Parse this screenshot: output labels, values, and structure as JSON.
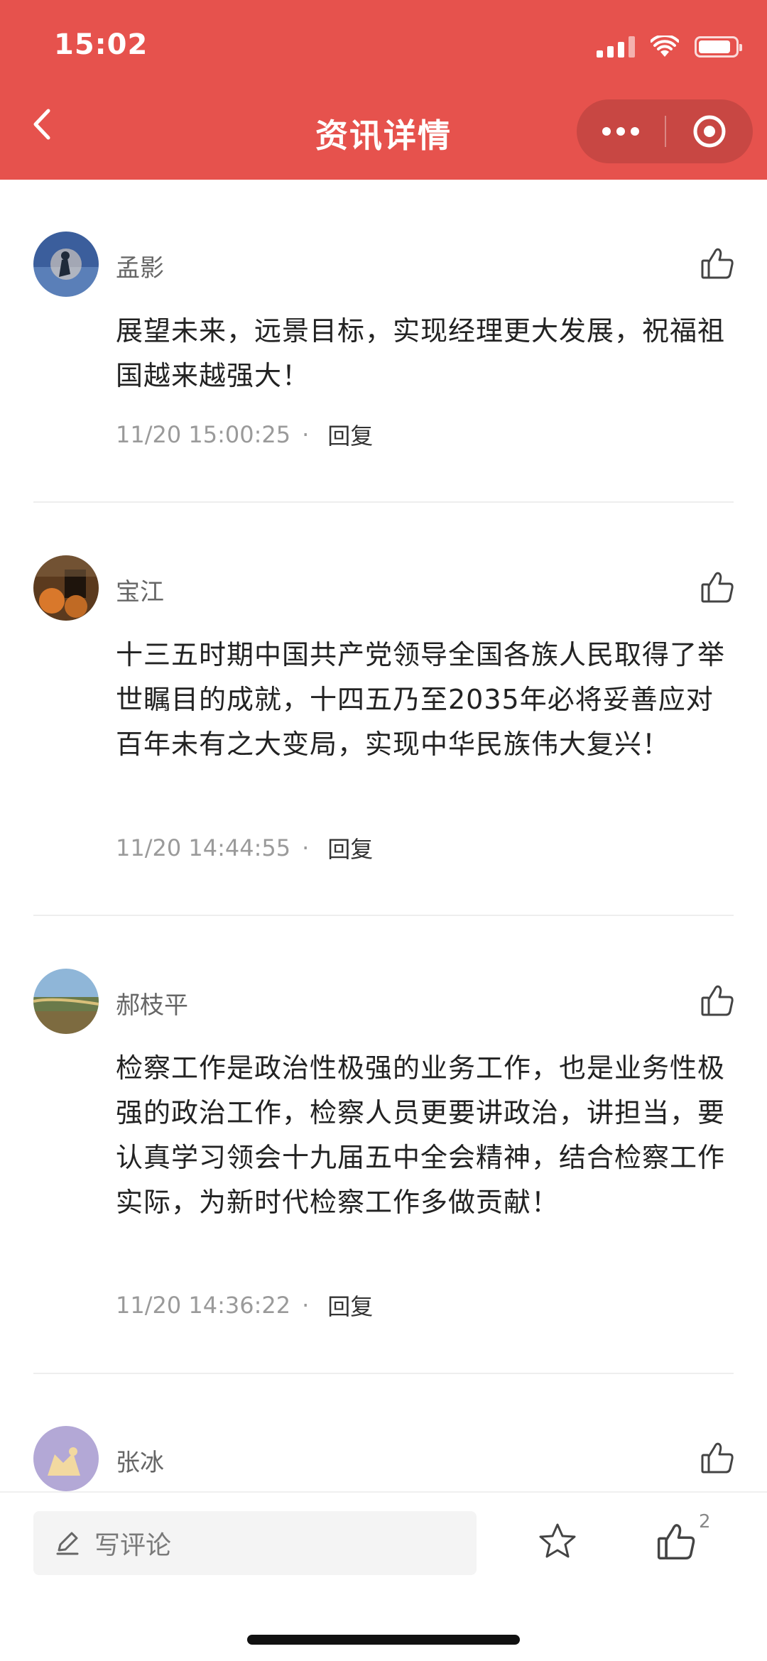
{
  "status_bar": {
    "time": "15:02"
  },
  "header": {
    "title": "资讯详情"
  },
  "comments": [
    {
      "name": "孟影",
      "text": "展望未来，远景目标，实现经理更大发展，祝福祖国越来越强大！",
      "time": "11/20 15:00:25",
      "dot": "·",
      "reply": "回复"
    },
    {
      "name": "宝江",
      "text": "十三五时期中国共产党领导全国各族人民取得了举世瞩目的成就，十四五乃至2035年必将妥善应对百年未有之大变局，实现中华民族伟大复兴！",
      "time": "11/20 14:44:55",
      "dot": "·",
      "reply": "回复"
    },
    {
      "name": "郝枝平",
      "text": "检察工作是政治性极强的业务工作，也是业务性极强的政治工作，检察人员更要讲政治，讲担当，要认真学习领会十九届五中全会精神，结合检察工作实际，为新时代检察工作多做贡献！",
      "time": "11/20 14:36:22",
      "dot": "·",
      "reply": "回复"
    },
    {
      "name": "张冰"
    }
  ],
  "bottom_bar": {
    "comment_placeholder": "写评论",
    "like_count": "2"
  },
  "colors": {
    "header_bg": "#e6524d",
    "text_primary": "#222222",
    "text_secondary": "#9a9a9a"
  },
  "icons": [
    "back-icon",
    "more-icon",
    "target-icon",
    "like-icon",
    "pen-icon",
    "star-icon"
  ]
}
